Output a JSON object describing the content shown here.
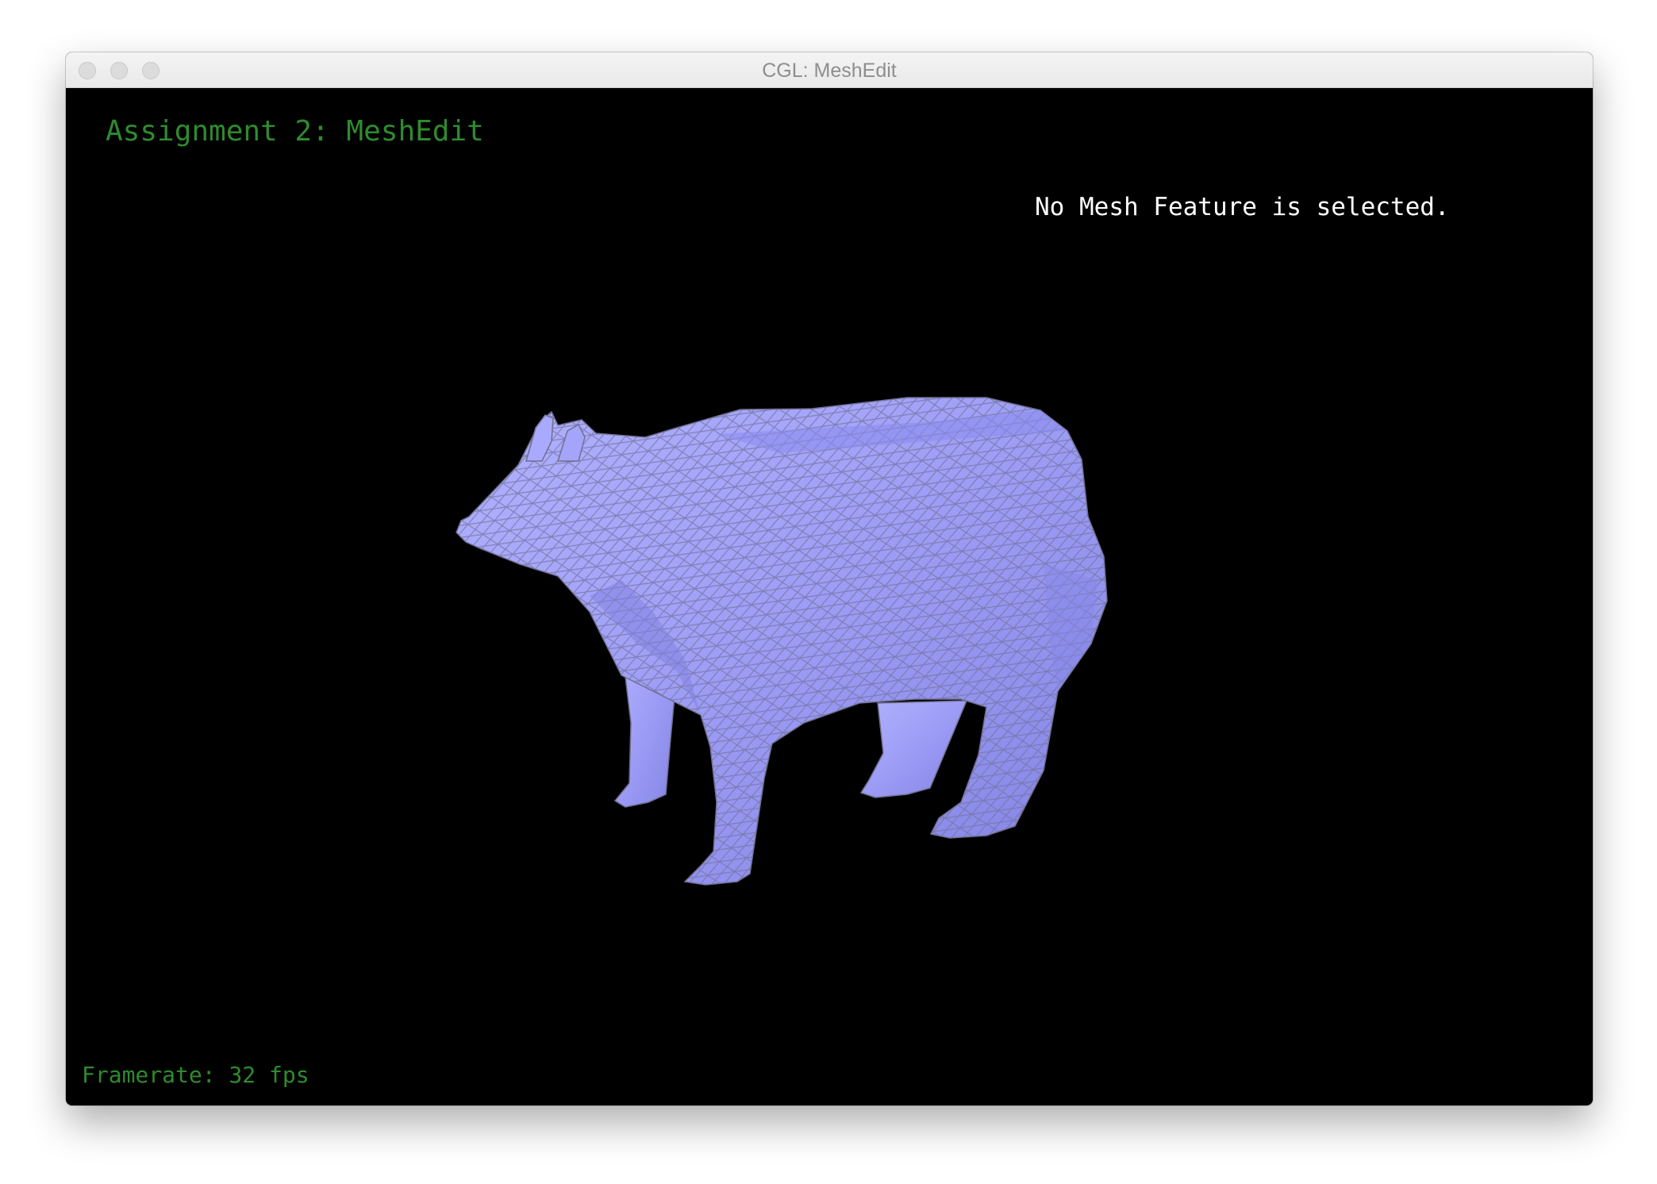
{
  "window": {
    "title": "CGL: MeshEdit"
  },
  "viewport": {
    "assignment_title": "Assignment 2: MeshEdit",
    "selection_status": "No Mesh Feature is selected.",
    "framerate": "Framerate: 32 fps",
    "mesh": {
      "subject": "bear",
      "fill_color": "#9d9df5",
      "edge_color": "#6f6f8f"
    }
  },
  "colors": {
    "background": "#000000",
    "overlay_text_green": "#2e8b2e",
    "overlay_text_white": "#ffffff"
  }
}
